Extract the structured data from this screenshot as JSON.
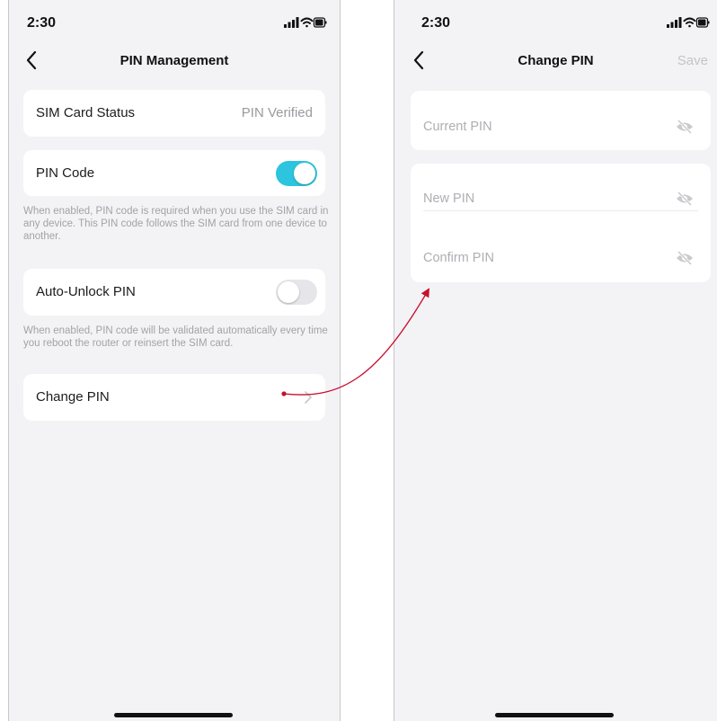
{
  "left_screen": {
    "status_time": "2:30",
    "title": "PIN Management",
    "sim_card": {
      "label": "SIM Card Status",
      "value": "PIN Verified"
    },
    "pin_code": {
      "label": "PIN Code",
      "enabled": true,
      "hint": "When enabled, PIN code is required when you use the SIM card in any device. This PIN code follows the SIM card from one device to another."
    },
    "auto_unlock": {
      "label": "Auto-Unlock PIN",
      "enabled": false,
      "hint": "When enabled, PIN code will be validated automatically every time you reboot the router or reinsert the SIM card."
    },
    "change_pin": {
      "label": "Change PIN"
    }
  },
  "right_screen": {
    "status_time": "2:30",
    "title": "Change PIN",
    "save_label": "Save",
    "fields": {
      "current": "Current PIN",
      "new": "New PIN",
      "confirm": "Confirm PIN"
    }
  },
  "colors": {
    "accent": "#2cc4de",
    "annotation_arrow": "#c8102e",
    "background": "#f3f3f6"
  },
  "icons": [
    "back-icon",
    "signal-icon",
    "wifi-icon",
    "battery-icon",
    "chevron-right-icon",
    "eye-off-icon"
  ]
}
